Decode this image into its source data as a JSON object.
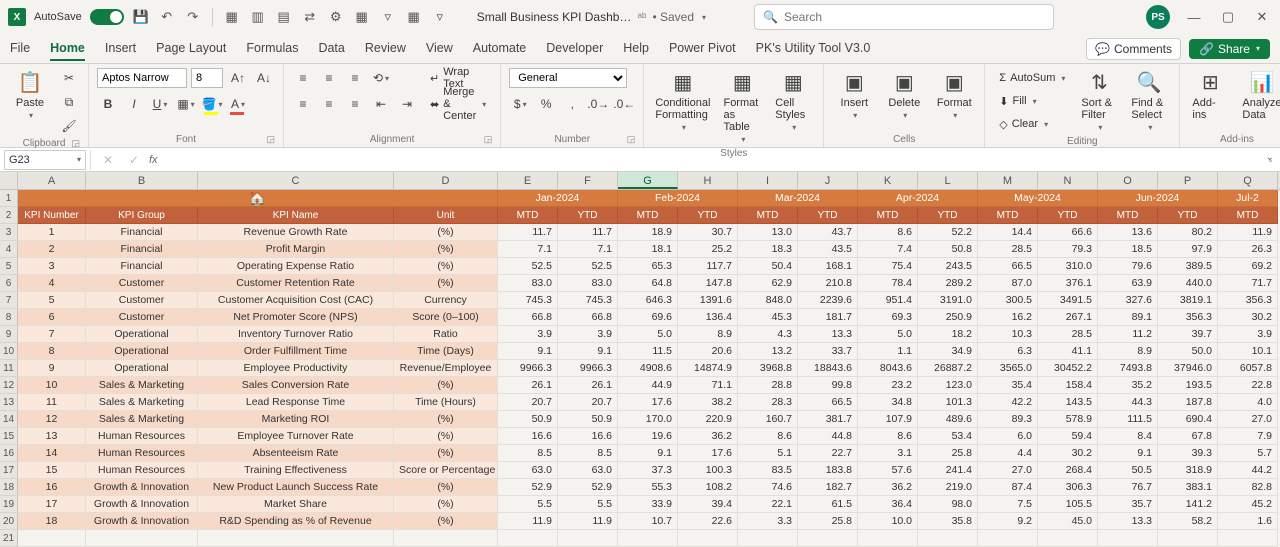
{
  "titlebar": {
    "autosave_label": "AutoSave",
    "doc_title": "Small Business KPI Dashb…",
    "saved_state": "• Saved",
    "search_placeholder": "Search",
    "user_initials": "PS"
  },
  "tabs": {
    "items": [
      "File",
      "Home",
      "Insert",
      "Page Layout",
      "Formulas",
      "Data",
      "Review",
      "View",
      "Automate",
      "Developer",
      "Help",
      "Power Pivot",
      "PK's Utility Tool V3.0"
    ],
    "active_index": 1,
    "comments": "Comments",
    "share": "Share"
  },
  "ribbon": {
    "clipboard": {
      "paste": "Paste",
      "label": "Clipboard"
    },
    "font": {
      "name": "Aptos Narrow",
      "size": "8",
      "label": "Font"
    },
    "alignment": {
      "wrap": "Wrap Text",
      "merge": "Merge & Center",
      "label": "Alignment"
    },
    "number": {
      "format": "General",
      "label": "Number"
    },
    "styles": {
      "cond": "Conditional Formatting",
      "fmt_table": "Format as Table",
      "cell_styles": "Cell Styles",
      "label": "Styles"
    },
    "cells": {
      "insert": "Insert",
      "delete": "Delete",
      "format": "Format",
      "label": "Cells"
    },
    "editing": {
      "autosum": "AutoSum",
      "fill": "Fill",
      "clear": "Clear",
      "sort": "Sort & Filter",
      "find": "Find & Select",
      "label": "Editing"
    },
    "addins": {
      "addins": "Add-ins",
      "analyze": "Analyze Data",
      "label": "Add-ins"
    }
  },
  "namebox": "G23",
  "columns": [
    "A",
    "B",
    "C",
    "D",
    "E",
    "F",
    "G",
    "H",
    "I",
    "J",
    "K",
    "L",
    "M",
    "N",
    "O",
    "P",
    "Q"
  ],
  "month_headers": [
    "Jan-2024",
    "Feb-2024",
    "Mar-2024",
    "Apr-2024",
    "May-2024",
    "Jun-2024",
    "Jul-2"
  ],
  "col_headers2": [
    "KPI Number",
    "KPI Group",
    "KPI Name",
    "Unit",
    "MTD",
    "YTD",
    "MTD",
    "YTD",
    "MTD",
    "YTD",
    "MTD",
    "YTD",
    "MTD",
    "YTD",
    "MTD",
    "YTD",
    "MTD"
  ],
  "rows": [
    {
      "n": "1",
      "grp": "Financial",
      "name": "Revenue Growth Rate",
      "unit": "(%)",
      "v": [
        "11.7",
        "11.7",
        "18.9",
        "30.7",
        "13.0",
        "43.7",
        "8.6",
        "52.2",
        "14.4",
        "66.6",
        "13.6",
        "80.2",
        "11.9"
      ]
    },
    {
      "n": "2",
      "grp": "Financial",
      "name": "Profit Margin",
      "unit": "(%)",
      "v": [
        "7.1",
        "7.1",
        "18.1",
        "25.2",
        "18.3",
        "43.5",
        "7.4",
        "50.8",
        "28.5",
        "79.3",
        "18.5",
        "97.9",
        "26.3"
      ]
    },
    {
      "n": "3",
      "grp": "Financial",
      "name": "Operating Expense Ratio",
      "unit": "(%)",
      "v": [
        "52.5",
        "52.5",
        "65.3",
        "117.7",
        "50.4",
        "168.1",
        "75.4",
        "243.5",
        "66.5",
        "310.0",
        "79.6",
        "389.5",
        "69.2"
      ]
    },
    {
      "n": "4",
      "grp": "Customer",
      "name": "Customer Retention Rate",
      "unit": "(%)",
      "v": [
        "83.0",
        "83.0",
        "64.8",
        "147.8",
        "62.9",
        "210.8",
        "78.4",
        "289.2",
        "87.0",
        "376.1",
        "63.9",
        "440.0",
        "71.7"
      ]
    },
    {
      "n": "5",
      "grp": "Customer",
      "name": "Customer Acquisition Cost (CAC)",
      "unit": "Currency",
      "v": [
        "745.3",
        "745.3",
        "646.3",
        "1391.6",
        "848.0",
        "2239.6",
        "951.4",
        "3191.0",
        "300.5",
        "3491.5",
        "327.6",
        "3819.1",
        "356.3"
      ]
    },
    {
      "n": "6",
      "grp": "Customer",
      "name": "Net Promoter Score (NPS)",
      "unit": "Score (0–100)",
      "v": [
        "66.8",
        "66.8",
        "69.6",
        "136.4",
        "45.3",
        "181.7",
        "69.3",
        "250.9",
        "16.2",
        "267.1",
        "89.1",
        "356.3",
        "30.2"
      ]
    },
    {
      "n": "7",
      "grp": "Operational",
      "name": "Inventory Turnover Ratio",
      "unit": "Ratio",
      "v": [
        "3.9",
        "3.9",
        "5.0",
        "8.9",
        "4.3",
        "13.3",
        "5.0",
        "18.2",
        "10.3",
        "28.5",
        "11.2",
        "39.7",
        "3.9"
      ]
    },
    {
      "n": "8",
      "grp": "Operational",
      "name": "Order Fulfillment Time",
      "unit": "Time (Days)",
      "v": [
        "9.1",
        "9.1",
        "11.5",
        "20.6",
        "13.2",
        "33.7",
        "1.1",
        "34.9",
        "6.3",
        "41.1",
        "8.9",
        "50.0",
        "10.1"
      ]
    },
    {
      "n": "9",
      "grp": "Operational",
      "name": "Employee Productivity",
      "unit": "Revenue/Employee",
      "v": [
        "9966.3",
        "9966.3",
        "4908.6",
        "14874.9",
        "3968.8",
        "18843.6",
        "8043.6",
        "26887.2",
        "3565.0",
        "30452.2",
        "7493.8",
        "37946.0",
        "6057.8"
      ]
    },
    {
      "n": "10",
      "grp": "Sales & Marketing",
      "name": "Sales Conversion Rate",
      "unit": "(%)",
      "v": [
        "26.1",
        "26.1",
        "44.9",
        "71.1",
        "28.8",
        "99.8",
        "23.2",
        "123.0",
        "35.4",
        "158.4",
        "35.2",
        "193.5",
        "22.8"
      ]
    },
    {
      "n": "11",
      "grp": "Sales & Marketing",
      "name": "Lead Response Time",
      "unit": "Time (Hours)",
      "v": [
        "20.7",
        "20.7",
        "17.6",
        "38.2",
        "28.3",
        "66.5",
        "34.8",
        "101.3",
        "42.2",
        "143.5",
        "44.3",
        "187.8",
        "4.0"
      ]
    },
    {
      "n": "12",
      "grp": "Sales & Marketing",
      "name": "Marketing ROI",
      "unit": "(%)",
      "v": [
        "50.9",
        "50.9",
        "170.0",
        "220.9",
        "160.7",
        "381.7",
        "107.9",
        "489.6",
        "89.3",
        "578.9",
        "111.5",
        "690.4",
        "27.0"
      ]
    },
    {
      "n": "13",
      "grp": "Human Resources",
      "name": "Employee Turnover Rate",
      "unit": "(%)",
      "v": [
        "16.6",
        "16.6",
        "19.6",
        "36.2",
        "8.6",
        "44.8",
        "8.6",
        "53.4",
        "6.0",
        "59.4",
        "8.4",
        "67.8",
        "7.9"
      ]
    },
    {
      "n": "14",
      "grp": "Human Resources",
      "name": "Absenteeism Rate",
      "unit": "(%)",
      "v": [
        "8.5",
        "8.5",
        "9.1",
        "17.6",
        "5.1",
        "22.7",
        "3.1",
        "25.8",
        "4.4",
        "30.2",
        "9.1",
        "39.3",
        "5.7"
      ]
    },
    {
      "n": "15",
      "grp": "Human Resources",
      "name": "Training Effectiveness",
      "unit": "Score or Percentage",
      "v": [
        "63.0",
        "63.0",
        "37.3",
        "100.3",
        "83.5",
        "183.8",
        "57.6",
        "241.4",
        "27.0",
        "268.4",
        "50.5",
        "318.9",
        "44.2"
      ]
    },
    {
      "n": "16",
      "grp": "Growth & Innovation",
      "name": "New Product Launch Success Rate",
      "unit": "(%)",
      "v": [
        "52.9",
        "52.9",
        "55.3",
        "108.2",
        "74.6",
        "182.7",
        "36.2",
        "219.0",
        "87.4",
        "306.3",
        "76.7",
        "383.1",
        "82.8"
      ]
    },
    {
      "n": "17",
      "grp": "Growth & Innovation",
      "name": "Market Share",
      "unit": "(%)",
      "v": [
        "5.5",
        "5.5",
        "33.9",
        "39.4",
        "22.1",
        "61.5",
        "36.4",
        "98.0",
        "7.5",
        "105.5",
        "35.7",
        "141.2",
        "45.2"
      ]
    },
    {
      "n": "18",
      "grp": "Growth & Innovation",
      "name": "R&D Spending as % of Revenue",
      "unit": "(%)",
      "v": [
        "11.9",
        "11.9",
        "10.7",
        "22.6",
        "3.3",
        "25.8",
        "10.0",
        "35.8",
        "9.2",
        "45.0",
        "13.3",
        "58.2",
        "1.6"
      ]
    }
  ]
}
